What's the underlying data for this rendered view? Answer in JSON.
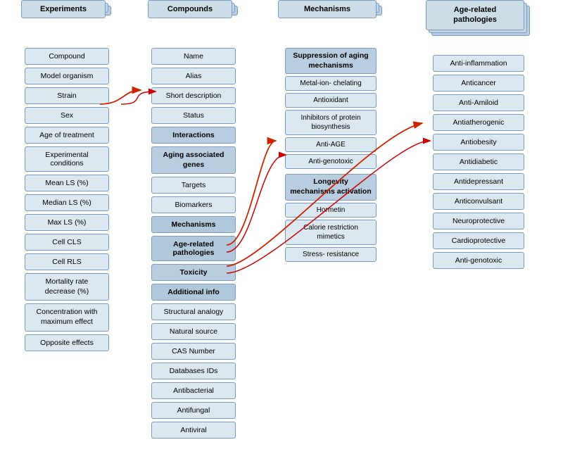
{
  "columns": {
    "experiments": {
      "header": "Experiments",
      "items": [
        "Compound",
        "Model organism",
        "Strain",
        "Sex",
        "Age of treatment",
        "Experimental conditions",
        "Mean LS (%)",
        "Median LS (%)",
        "Max LS (%)",
        "Cell CLS",
        "Cell RLS",
        "Mortality rate decrease (%)",
        "Concentration with maximum effect",
        "Opposite effects"
      ]
    },
    "compounds": {
      "header": "Compounds",
      "items": [
        "Name",
        "Alias",
        "Short description",
        "Status",
        "Interactions",
        "Aging associated genes",
        "Targets",
        "Biomarkers",
        "Mechanisms",
        "Age-related pathologies",
        "Toxicity",
        "Additional info",
        "Structural analogy",
        "Natural source",
        "CAS Number",
        "Databases IDs",
        "Antibacterial",
        "Antifungal",
        "Antiviral"
      ],
      "highlighted": [
        "Mechanisms",
        "Age-related pathologies"
      ]
    },
    "mechanisms": {
      "header": "Mechanisms",
      "suppression_header": "Suppression of aging mechanisms",
      "suppression_items": [
        "Metal-ion- chelating",
        "Antioxidant",
        "Inhibitors of protein biosynthesis",
        "Anti-AGE",
        "Anti-genotoxic"
      ],
      "longevity_header": "Longevity mechanisms activation",
      "longevity_items": [
        "Hormetin",
        "Calorie restriction mimetics",
        "Stress- resistance"
      ]
    },
    "pathologies": {
      "header": "Age-related pathologies",
      "items": [
        "Anti-inflammation",
        "Anticancer",
        "Anti-Amiloid",
        "Antiatherogenic",
        "Antiobesity",
        "Antidiabetic",
        "Antidepressant",
        "Anticonvulsant",
        "Neuroprotective",
        "Cardioprotective",
        "Anti-genotoxic"
      ]
    }
  }
}
